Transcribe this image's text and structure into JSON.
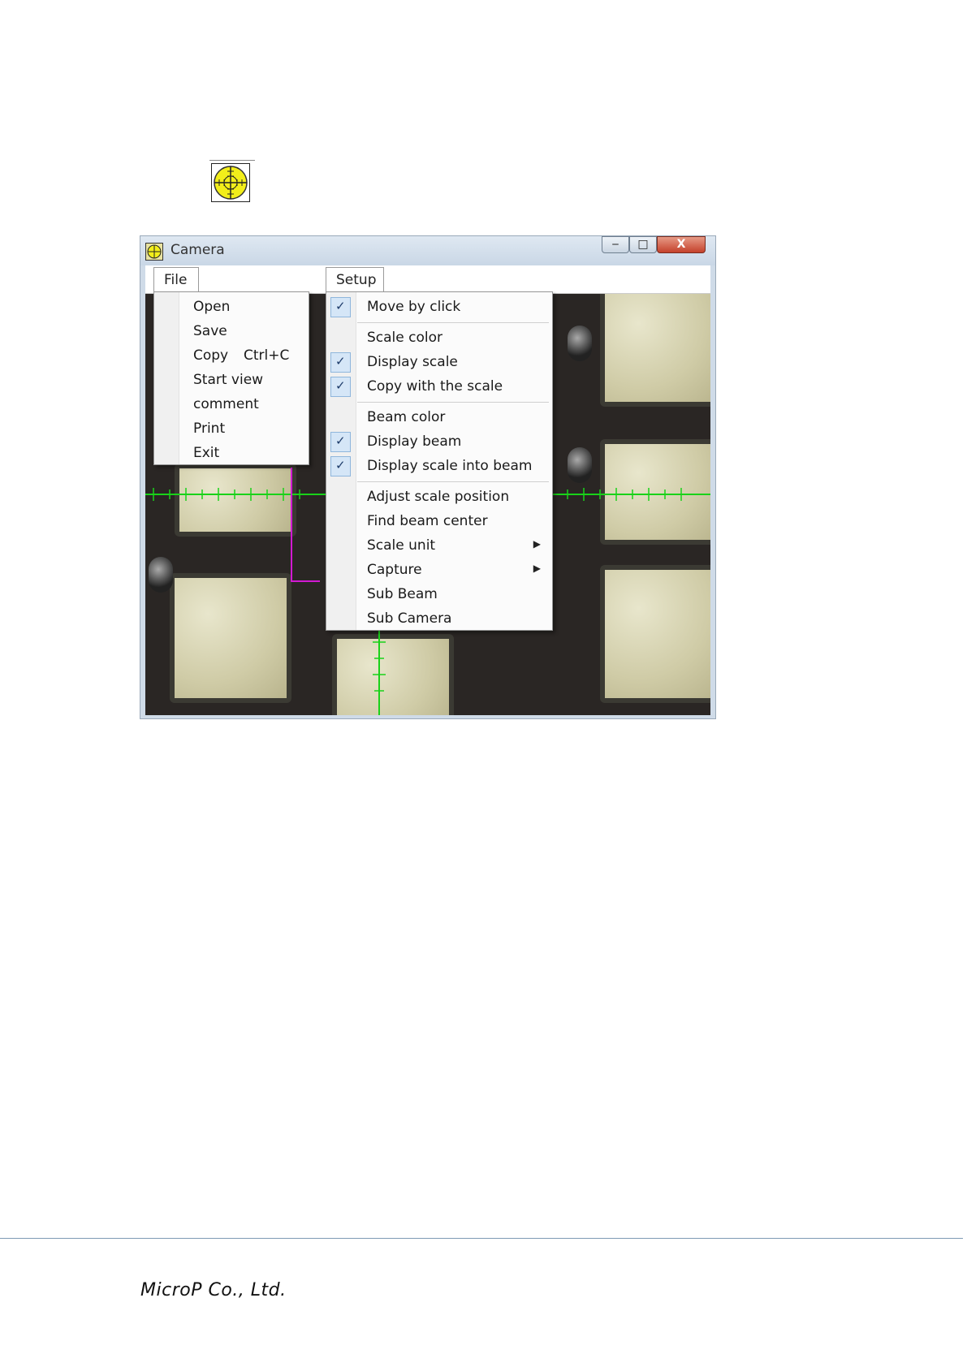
{
  "window": {
    "title": "Camera",
    "controls": {
      "minimize": "‒",
      "maximize": "□",
      "close": "X"
    }
  },
  "menubar": {
    "file": "File",
    "setup": "Setup"
  },
  "file_menu": {
    "items": [
      {
        "label": "Open"
      },
      {
        "label": "Save"
      },
      {
        "label": "Copy",
        "shortcut": "Ctrl+C"
      },
      {
        "label": "Start view"
      },
      {
        "label": "comment"
      },
      {
        "label": "Print"
      },
      {
        "label": "Exit"
      }
    ]
  },
  "setup_menu": {
    "items": [
      {
        "label": "Move by click",
        "checked": true
      },
      {
        "label": "Scale color",
        "checked": false
      },
      {
        "label": "Display scale",
        "checked": true
      },
      {
        "label": "Copy with the scale",
        "checked": true
      },
      {
        "label": "Beam color",
        "checked": false
      },
      {
        "label": "Display beam",
        "checked": true
      },
      {
        "label": "Display scale into beam",
        "checked": true
      },
      {
        "label": "Adjust scale position",
        "checked": false
      },
      {
        "label": "Find beam center",
        "checked": false
      },
      {
        "label": "Scale unit",
        "checked": false,
        "submenu": true
      },
      {
        "label": "Capture",
        "checked": false,
        "submenu": true
      },
      {
        "label": "Sub Beam",
        "checked": false
      },
      {
        "label": "Sub Camera",
        "checked": false
      }
    ],
    "check_glyph": "✓",
    "submenu_glyph": "▶"
  },
  "colors": {
    "scale_line": "#19d219",
    "beam_line": "#d219d2",
    "icon_yellow": "#f2ee1a"
  },
  "icons": {
    "toolbar": "crosshair-target-icon",
    "title": "crosshair-target-icon"
  },
  "footer": {
    "company": "MicroP Co., Ltd."
  }
}
